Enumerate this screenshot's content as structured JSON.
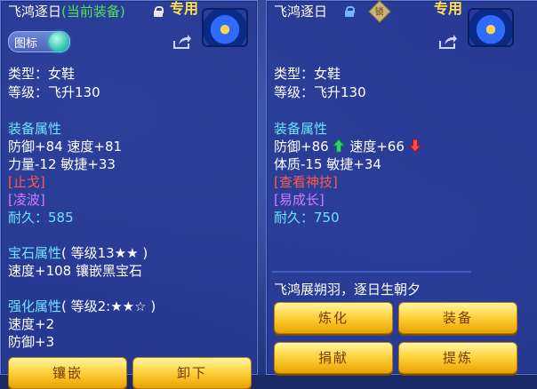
{
  "left_panel": {
    "item_name": "飞鸿逐日",
    "current_tag": "(当前装备)",
    "exclusive": "专用",
    "toggle_label": "图标",
    "type_line": "类型：女鞋",
    "level_line": "等级：飞升130",
    "attr_header": "装备属性",
    "stat_line_1": "防御+84 速度+81",
    "stat_line_2": "力量-12 敏捷+33",
    "special_1": "[止戈]",
    "special_2": "[凌波]",
    "durability_label": "耐久：",
    "durability_value": "585",
    "gem_header": "宝石属性",
    "gem_level": "( 等级13★★ )",
    "gem_line": "速度+108 镶嵌黑宝石",
    "enhance_header": "强化属性",
    "enhance_level": "( 等级2:★★☆ )",
    "enhance_line_1": "速度+2",
    "enhance_line_2": "防御+3",
    "button_inlay": "镶嵌",
    "button_unequip": "卸下"
  },
  "right_panel": {
    "item_name": "飞鸿逐日",
    "exclusive": "专用",
    "badge": "锁",
    "type_line": "类型：女鞋",
    "level_line": "等级：飞升130",
    "attr_header": "装备属性",
    "stat_defense": "防御+86",
    "stat_speed": "速度+66",
    "stat_line_2": "体质-15 敏捷+34",
    "link_view_skill": "[查看神技]",
    "link_growth": "[易成长]",
    "durability_label": "耐久：",
    "durability_value": "750",
    "flavor_text": "飞鸿展朔羽，逐日生朝夕",
    "button_refine": "炼化",
    "button_equip": "装备",
    "button_donate": "捐献",
    "button_extract": "提炼"
  },
  "colors": {
    "panel_bg": "#283a96",
    "title_white": "#ffffff",
    "current_green": "#52e05a",
    "exclusive_gold": "#ffe14a",
    "cyan": "#6ee3ff",
    "purple": "#d27cff",
    "red": "#ff5a4a",
    "button_gold": "#ffd43f"
  },
  "icons": [
    "lock-icon",
    "share-icon",
    "item-icon-shoes",
    "arrow-up-icon",
    "arrow-down-icon",
    "badge-icon"
  ]
}
